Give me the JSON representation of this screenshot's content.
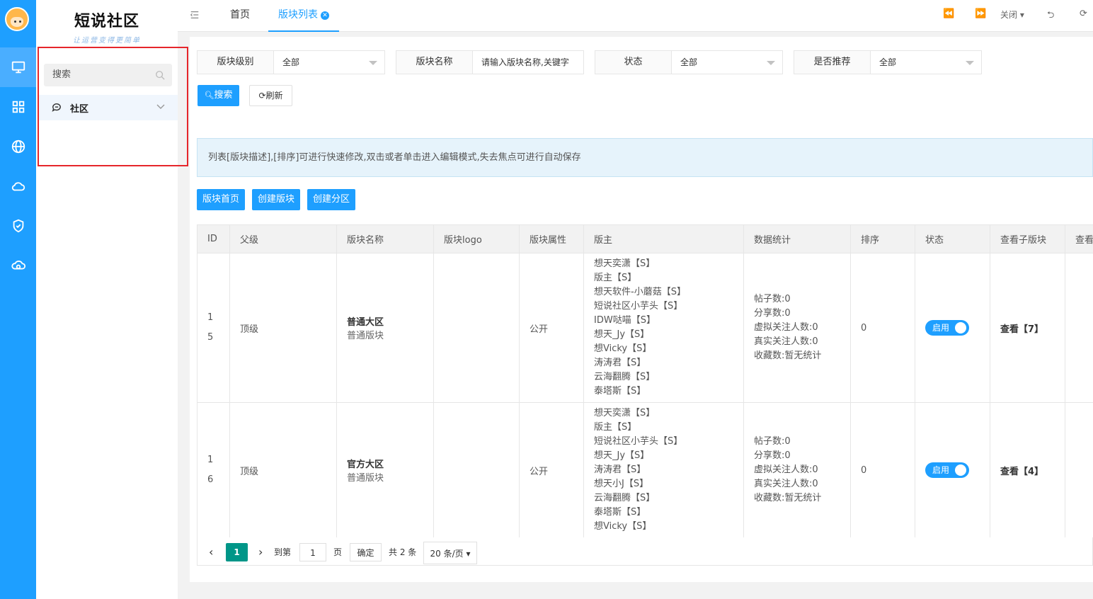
{
  "logo": {
    "title": "短说社区",
    "tagline": "让运营变得更简单"
  },
  "sidebar": {
    "search_placeholder": "搜索",
    "menu": [
      {
        "label": "社区",
        "icon": "chat-icon"
      }
    ]
  },
  "rail": {
    "items": [
      "monitor-icon",
      "grid-icon",
      "globe-icon",
      "cloud-icon",
      "shield-icon",
      "cloud-cycle-icon"
    ]
  },
  "topbar": {
    "tabs": [
      {
        "label": "首页"
      },
      {
        "label": "版块列表",
        "active": true
      }
    ],
    "close_label": "关闭"
  },
  "filters": [
    {
      "label": "版块级别",
      "value": "全部",
      "type": "select"
    },
    {
      "label": "版块名称",
      "placeholder": "请输入版块名称,关键字",
      "type": "input"
    },
    {
      "label": "状态",
      "value": "全部",
      "type": "select"
    },
    {
      "label": "是否推荐",
      "value": "全部",
      "type": "select"
    }
  ],
  "buttons": {
    "search": "搜索",
    "refresh": "刷新",
    "forum_home": "版块首页",
    "create_forum": "创建版块",
    "create_zone": "创建分区"
  },
  "notice": "列表[版块描述],[排序]可进行快速修改,双击或者单击进入编辑模式,失去焦点可进行自动保存",
  "table": {
    "headers": [
      "ID",
      "父级",
      "版块名称",
      "版块logo",
      "版块属性",
      "版主",
      "数据统计",
      "排序",
      "状态",
      "查看子版块",
      "查看"
    ],
    "rows": [
      {
        "id_line1": "1",
        "id_line2": "5",
        "parent": "顶级",
        "name": "普通大区",
        "name_sub": "普通版块",
        "attr": "公开",
        "moderators": [
          "想天奕潇【S】",
          "版主【S】",
          "想天软件-小蘑菇【S】",
          "短说社区小芋头【S】",
          "IDW哒喵【S】",
          "想天_Jy【S】",
          "想Vicky【S】",
          "涛涛君【S】",
          "云海翻腾【S】",
          "泰塔斯【S】"
        ],
        "stats": [
          "帖子数:0",
          "分享数:0",
          "虚拟关注人数:0",
          "真实关注人数:0",
          "收藏数:暂无统计"
        ],
        "sort": "0",
        "status": "启用",
        "view": "查看【7】"
      },
      {
        "id_line1": "1",
        "id_line2": "6",
        "parent": "顶级",
        "name": "官方大区",
        "name_sub": "普通版块",
        "attr": "公开",
        "moderators": [
          "想天奕潇【S】",
          "版主【S】",
          "短说社区小芋头【S】",
          "想天_Jy【S】",
          "涛涛君【S】",
          "想天小J【S】",
          "云海翻腾【S】",
          "泰塔斯【S】",
          "想Vicky【S】"
        ],
        "stats": [
          "帖子数:0",
          "分享数:0",
          "虚拟关注人数:0",
          "真实关注人数:0",
          "收藏数:暂无统计"
        ],
        "sort": "0",
        "status": "启用",
        "view": "查看【4】"
      }
    ]
  },
  "pagination": {
    "current": "1",
    "goto_label": "到第",
    "goto_value": "1",
    "page_label": "页",
    "confirm": "确定",
    "total": "共 2 条",
    "page_size": "20 条/页"
  },
  "colors": {
    "primary": "#1e9fff",
    "pager_active": "#009688",
    "highlight_border": "#e6262b"
  }
}
